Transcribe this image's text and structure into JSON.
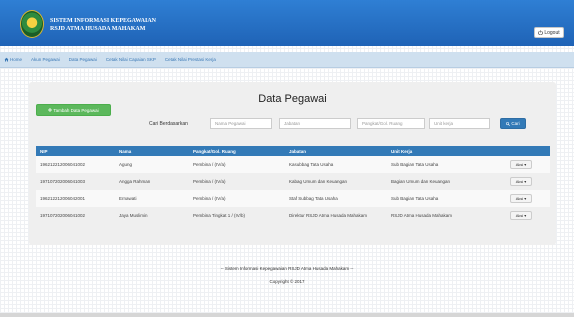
{
  "header": {
    "title_line1": "SISTEM INFORMASI KEPEGAWAIAN",
    "title_line2": "RSJD ATMA HUSADA MAHAKAM",
    "logout_label": "Logout"
  },
  "nav": {
    "items": [
      {
        "label": "Home",
        "icon": "home-icon"
      },
      {
        "label": "Akun Pegawai"
      },
      {
        "label": "Data Pegawai"
      },
      {
        "label": "Cetak Nilai Capaian SKP"
      },
      {
        "label": "Cetak Nilai Prestasi Kerja"
      }
    ]
  },
  "panel": {
    "title": "Data Pegawai",
    "add_button": "Tambah Data Pegawai",
    "search_label": "Cari Berdasarkan",
    "search_fields": [
      {
        "placeholder": "Nama Pegawai"
      },
      {
        "placeholder": "Jabatan"
      },
      {
        "placeholder": "Pangkat/Gol. Ruang"
      },
      {
        "placeholder": "Unit kerja"
      }
    ],
    "search_button": "Cari"
  },
  "table": {
    "columns": [
      "NIP",
      "Nama",
      "Pangkat/Gol. Ruang",
      "Jabatan",
      "Unit Kerja"
    ],
    "rows": [
      {
        "nip": "196212212006041002",
        "nama": "Agung",
        "pangkat": "Pembina / (IV/a)",
        "jabatan": "Kasubbag Tata Usaha",
        "unit": "Sub Bagian Tata Usaha",
        "aksi": "Aksi"
      },
      {
        "nip": "197107202006041003",
        "nama": "Angga Rahman",
        "pangkat": "Pembina / (IV/a)",
        "jabatan": "Kabag Umum dan Keuangan",
        "unit": "Bagian Umum dan Keuangan",
        "aksi": "Aksi"
      },
      {
        "nip": "196212212006042001",
        "nama": "Ernawati",
        "pangkat": "Pembina / (IV/a)",
        "jabatan": "Staf Subbag Tata Usaha",
        "unit": "Sub Bagian Tata Usaha",
        "aksi": "Aksi"
      },
      {
        "nip": "197107202006041002",
        "nama": "Jaya Muslimin",
        "pangkat": "Pembina Tingkat 1 / (IV/b)",
        "jabatan": "Direktur RSJD Atma Husada Mahakam",
        "unit": "RSJD Atma Husada Mahakam",
        "aksi": "Aksi"
      }
    ]
  },
  "footer": {
    "line1": "-- Sistem Informasi Kepegawaian RSJD Atma Husada Mahakam --",
    "line2": "Copyright © 2017"
  },
  "colors": {
    "header_blue": "#2a74c8",
    "nav_bg": "#cfe0ef",
    "primary": "#337ab7",
    "success": "#5cb85c"
  }
}
